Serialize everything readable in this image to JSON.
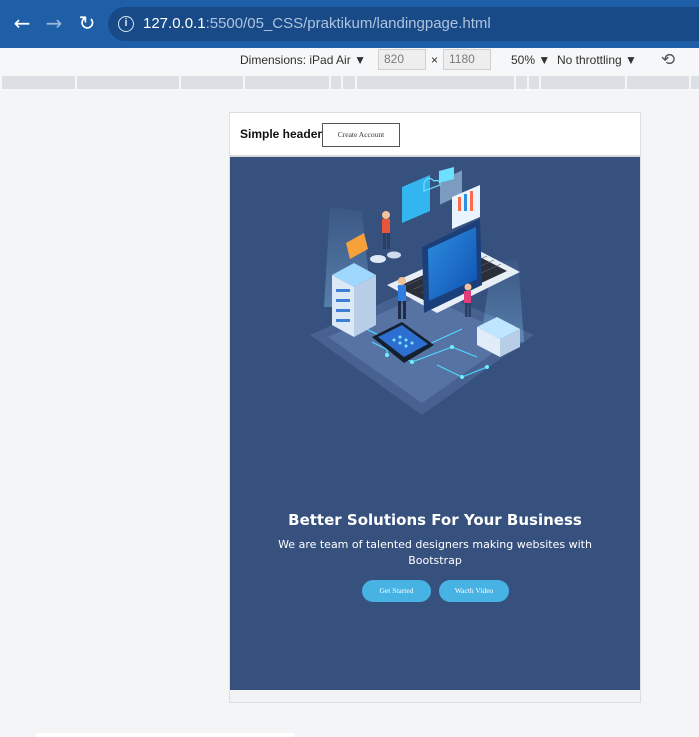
{
  "browser": {
    "url_host": "127.0.0.1",
    "url_rest": ":5500/05_CSS/praktikum/landingpage.html"
  },
  "devtools": {
    "dimensions_label": "Dimensions: iPad Air",
    "width": "820",
    "times": "×",
    "height": "1180",
    "zoom": "50%",
    "throttling": "No throttling"
  },
  "page": {
    "header": {
      "title": "Simple header",
      "button": "Create Account"
    },
    "hero": {
      "title": "Better Solutions For Your Business",
      "subtitle": "We are team of talented designers making websites with Bootstrap",
      "primary_button": "Get Started",
      "secondary_button": "Wacth Video"
    }
  },
  "colors": {
    "browser_bar": "#1f5fa8",
    "hero_bg": "#37517e",
    "accent": "#47b2e4"
  },
  "icons": [
    "back-arrow-icon",
    "forward-arrow-icon",
    "reload-icon",
    "info-icon",
    "dropdown-caret-icon",
    "rotate-icon"
  ]
}
